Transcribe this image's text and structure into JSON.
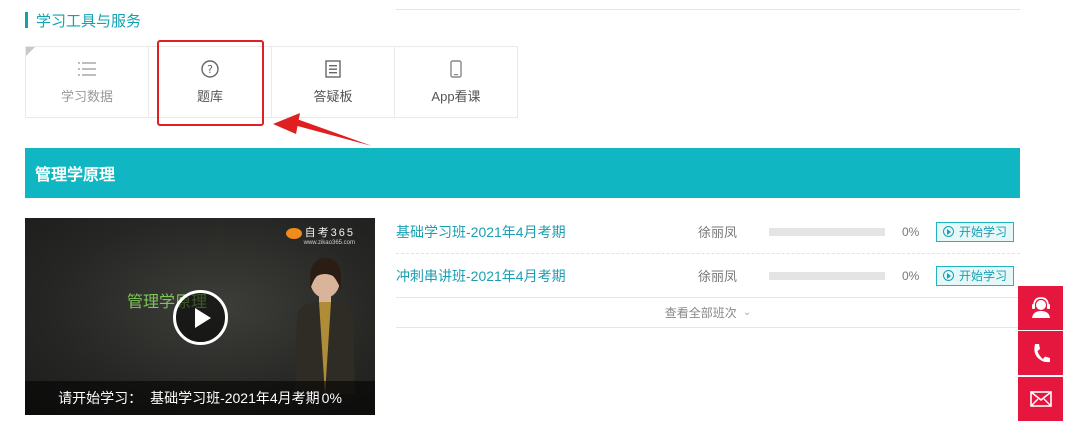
{
  "section": {
    "title": "学习工具与服务"
  },
  "tools": [
    {
      "label": "学习数据",
      "icon": "list-icon",
      "disabled": true
    },
    {
      "label": "题库",
      "icon": "question-circle-icon"
    },
    {
      "label": "答疑板",
      "icon": "document-icon"
    },
    {
      "label": "App看课",
      "icon": "phone-icon"
    }
  ],
  "course": {
    "title": "管理学原理"
  },
  "video": {
    "logo_brand": "自考365",
    "logo_url": "www.zikao365.com",
    "overlay_title": "管理学原理",
    "caption_prefix": "请开始学习：",
    "caption_class": "基础学习班-2021年4月考期",
    "caption_progress": "0%"
  },
  "classes": [
    {
      "name": "基础学习班-2021年4月考期",
      "teacher": "徐丽凤",
      "progress_pct": "0%",
      "progress": 0,
      "action": "开始学习"
    },
    {
      "name": "冲刺串讲班-2021年4月考期",
      "teacher": "徐丽凤",
      "progress_pct": "0%",
      "progress": 0,
      "action": "开始学习"
    }
  ],
  "more_label": "查看全部班次",
  "sidebar": [
    {
      "icon": "customer-service-icon"
    },
    {
      "icon": "phone-call-icon"
    },
    {
      "icon": "mail-icon"
    }
  ],
  "colors": {
    "accent": "#10b7c2",
    "link": "#1a9fb3",
    "side": "#e5173f",
    "highlight": "#e02020"
  }
}
